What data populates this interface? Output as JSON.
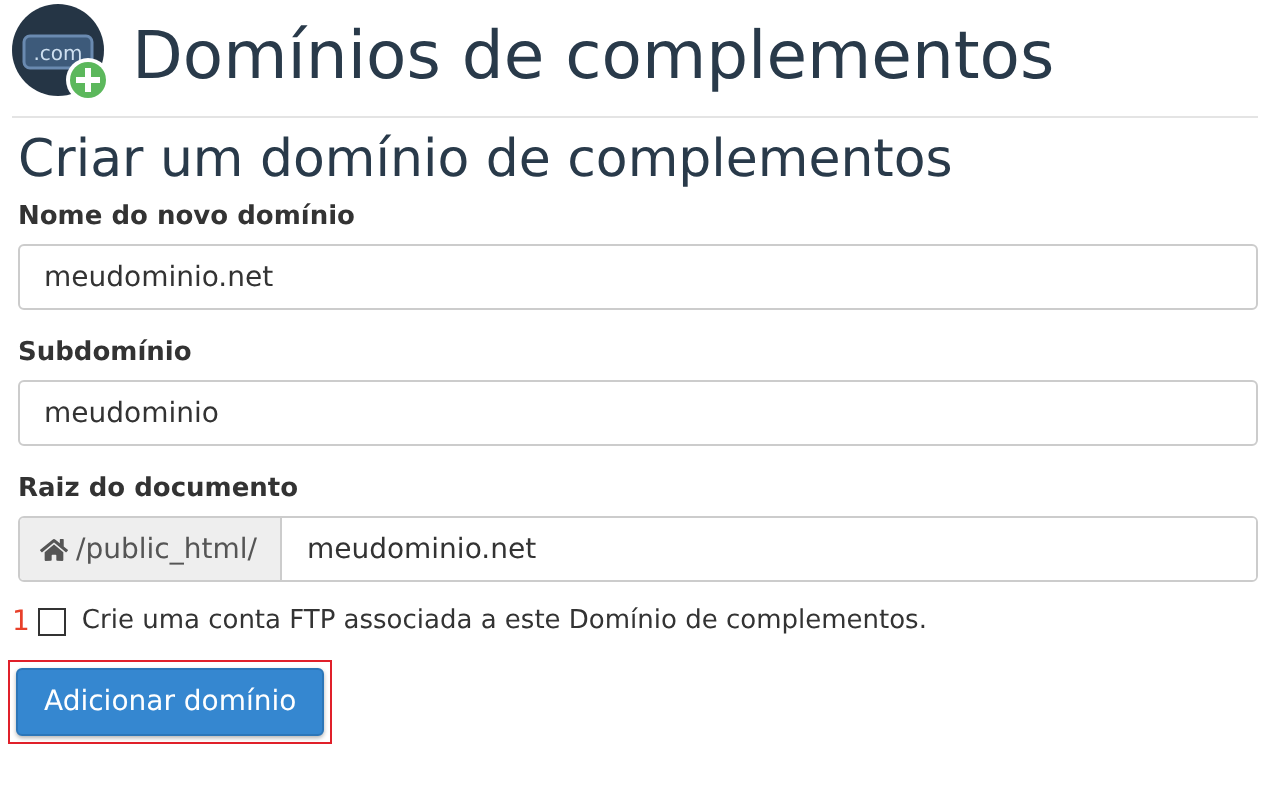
{
  "header": {
    "title": "Domínios de complementos",
    "icon_text": ".com"
  },
  "form": {
    "title": "Criar um domínio de complementos",
    "fields": [
      {
        "kind": "text",
        "label": "Nome do novo domínio",
        "value": "meudominio.net"
      },
      {
        "kind": "text",
        "label": "Subdomínio",
        "value": "meudominio"
      },
      {
        "kind": "prefixed",
        "label": "Raiz do documento",
        "prefix": "/public_html/",
        "value": "meudominio.net"
      }
    ],
    "ftp_checkbox": {
      "label": "Crie uma conta FTP associada a este Domínio de complementos.",
      "checked": false,
      "marker": "1"
    },
    "submit": {
      "label": "Adicionar domínio",
      "highlighted": true
    }
  }
}
